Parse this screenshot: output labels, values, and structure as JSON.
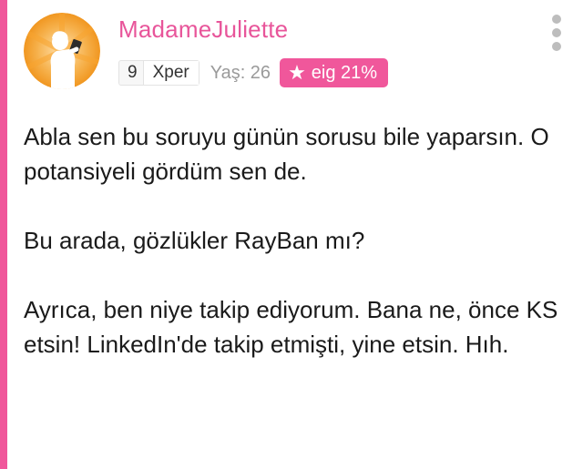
{
  "user": {
    "name": "MadameJuliette",
    "level": "9",
    "level_label": "Xper",
    "age": "Yaş: 26",
    "badge_text": "eig 21%",
    "badge_icon": "star-icon",
    "avatar_icon": "woman-reading-icon"
  },
  "menu_icon": "more-vertical-icon",
  "colors": {
    "accent": "#f0579b",
    "username": "#e8559a",
    "avatar_bg": "#f39b1f"
  },
  "post": {
    "paragraph_1": "Abla sen bu soruyu günün sorusu bile yaparsın. O potansiyeli gördüm sen de.",
    "paragraph_2": "Bu arada, gözlükler RayBan mı?",
    "paragraph_3": "Ayrıca, ben niye takip ediyorum. Bana ne, önce KS etsin! LinkedIn'de takip etmişti, yine etsin. Hıh."
  }
}
